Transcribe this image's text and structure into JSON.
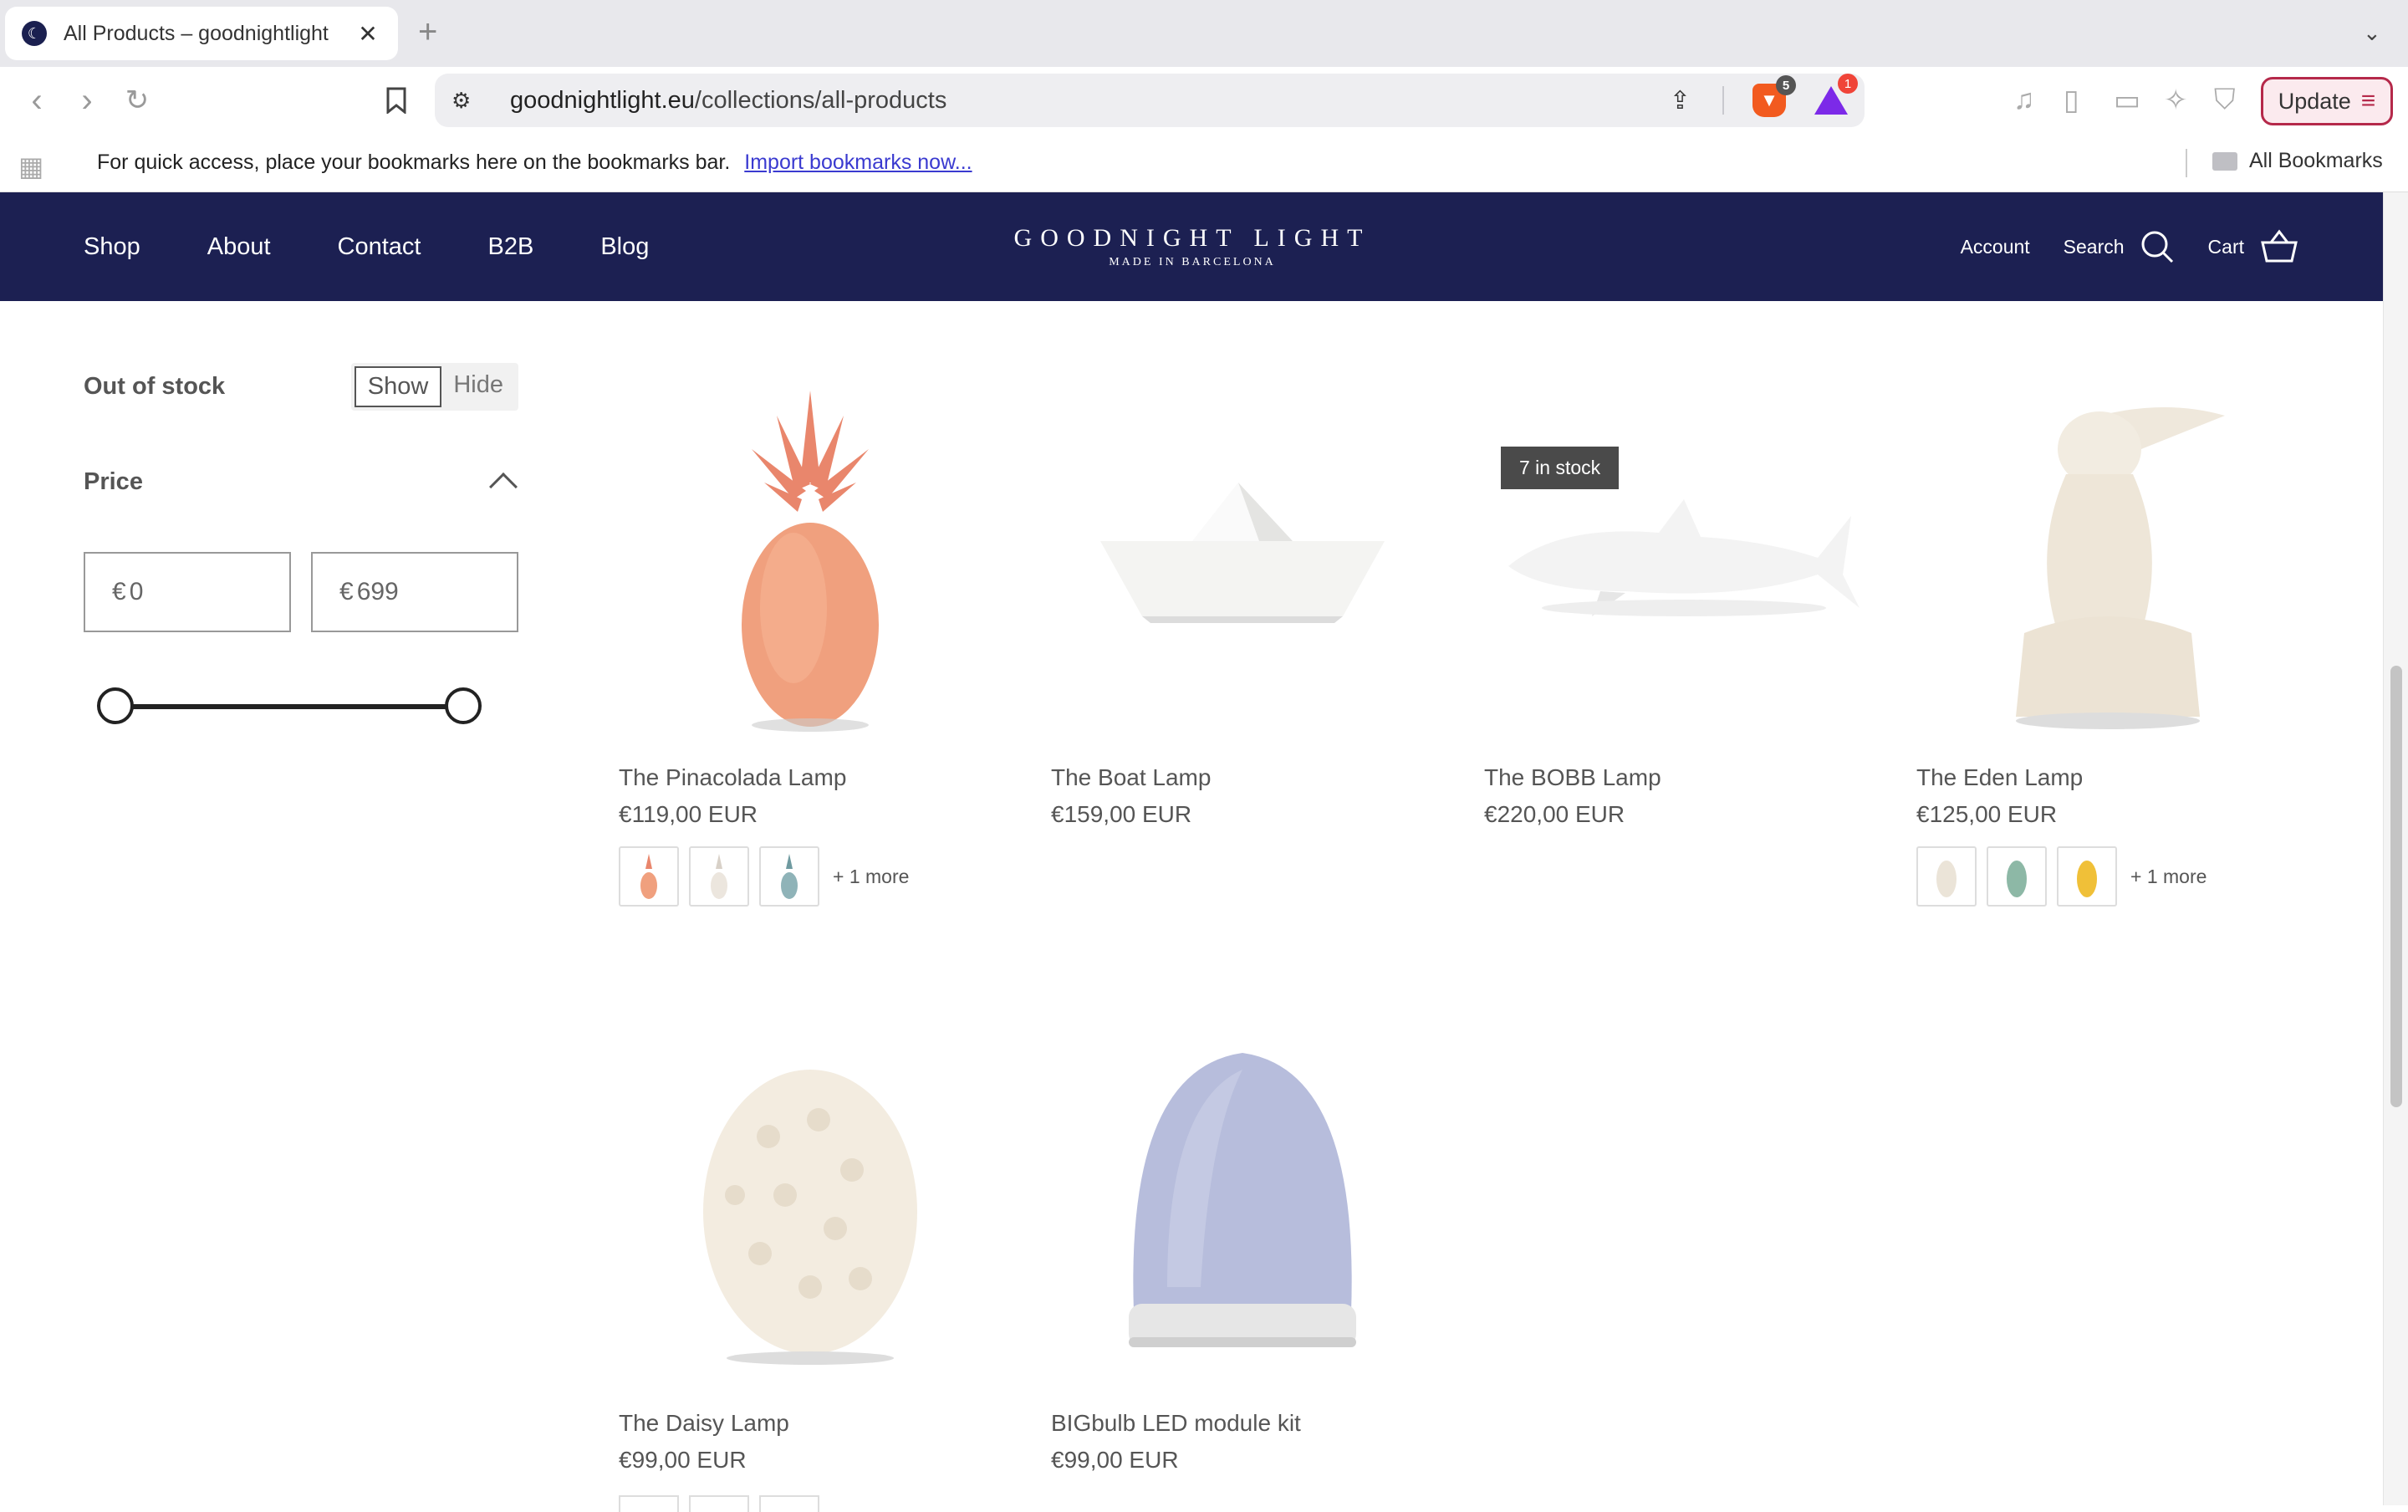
{
  "browser": {
    "tab_title": "All Products – goodnightlight",
    "tab_close": "✕",
    "new_tab": "+",
    "url_domain": "goodnightlight.eu",
    "url_path": "/collections/all-products",
    "brave_badge": "5",
    "rewards_badge": "1",
    "update_label": "Update"
  },
  "bookmarks_bar": {
    "message": "For quick access, place your bookmarks here on the bookmarks bar.",
    "import_link": "Import bookmarks now...",
    "all_bookmarks": "All Bookmarks"
  },
  "header": {
    "nav": [
      "Shop",
      "About",
      "Contact",
      "B2B",
      "Blog"
    ],
    "logo_main": "GOODNIGHT LIGHT",
    "logo_sub": "MADE IN BARCELONA",
    "account": "Account",
    "search": "Search",
    "cart": "Cart"
  },
  "filters": {
    "out_of_stock_label": "Out of stock",
    "show": "Show",
    "hide": "Hide",
    "price_label": "Price",
    "currency": "€",
    "min_value": "0",
    "max_value": "699",
    "slider_min_fraction": 0,
    "slider_max_fraction": 1
  },
  "products": [
    {
      "name": "The Pinacolada Lamp",
      "price": "€119,00 EUR",
      "more": "+ 1 more"
    },
    {
      "name": "The Boat Lamp",
      "price": "€159,00 EUR"
    },
    {
      "name": "The BOBB Lamp",
      "price": "€220,00 EUR",
      "badge": "7 in stock"
    },
    {
      "name": "The Eden Lamp",
      "price": "€125,00 EUR",
      "more": "+ 1 more"
    },
    {
      "name": "The Daisy Lamp",
      "price": "€99,00 EUR"
    },
    {
      "name": "BIGbulb LED module kit",
      "price": "€99,00 EUR"
    }
  ],
  "colors": {
    "header_bg": "#1c2052",
    "pinacolada": "#f0a07e",
    "ceramic_white": "#f4f1ec",
    "bulb_blue": "#b7bddc",
    "update_border": "#b5294a"
  }
}
